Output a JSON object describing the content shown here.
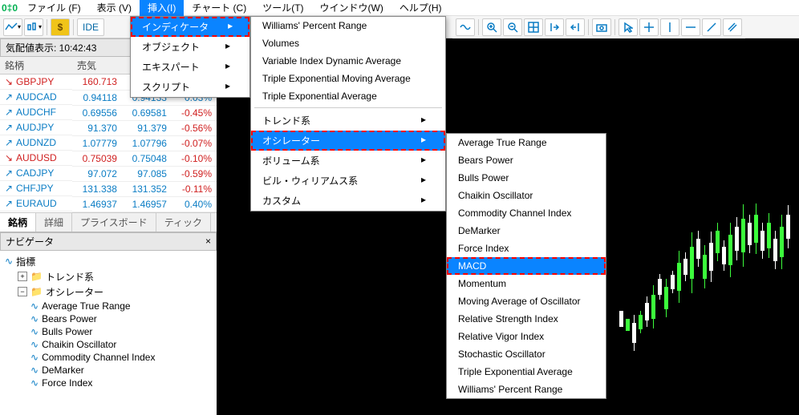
{
  "menubar": {
    "items": [
      "ファイル (F)",
      "表示 (V)",
      "挿入(I)",
      "チャート (C)",
      "ツール(T)",
      "ウインドウ(W)",
      "ヘルプ(H)"
    ],
    "active_index": 2
  },
  "toolbar": {
    "ide": "IDE"
  },
  "quotes_panel": {
    "title": "気配値表示: 10:42:43",
    "headers": [
      "銘柄",
      "売気"
    ],
    "rows": [
      {
        "sym": "GBPJPY",
        "dir": "dn",
        "bid": "160.713",
        "ask": "",
        "pct": ""
      },
      {
        "sym": "AUDCAD",
        "dir": "up",
        "bid": "0.94118",
        "ask": "0.94133",
        "pct": "0.03%"
      },
      {
        "sym": "AUDCHF",
        "dir": "up",
        "bid": "0.69556",
        "ask": "0.69581",
        "pct": "-0.45%"
      },
      {
        "sym": "AUDJPY",
        "dir": "up",
        "bid": "91.370",
        "ask": "91.379",
        "pct": "-0.56%"
      },
      {
        "sym": "AUDNZD",
        "dir": "up",
        "bid": "1.07779",
        "ask": "1.07796",
        "pct": "-0.07%"
      },
      {
        "sym": "AUDUSD",
        "dir": "dn",
        "bid": "0.75039",
        "ask": "0.75048",
        "pct": "-0.10%"
      },
      {
        "sym": "CADJPY",
        "dir": "up",
        "bid": "97.072",
        "ask": "97.085",
        "pct": "-0.59%"
      },
      {
        "sym": "CHFJPY",
        "dir": "up",
        "bid": "131.338",
        "ask": "131.352",
        "pct": "-0.11%"
      },
      {
        "sym": "EURAUD",
        "dir": "up",
        "bid": "1.46937",
        "ask": "1.46957",
        "pct": "0.40%"
      }
    ],
    "tabs": [
      "銘柄",
      "詳細",
      "プライスボード",
      "ティック"
    ],
    "active_tab": 0
  },
  "navigator": {
    "title": "ナビゲータ",
    "root": "指標",
    "groups": [
      {
        "name": "トレンド系",
        "open": false
      },
      {
        "name": "オシレーター",
        "open": true,
        "children": [
          "Average True Range",
          "Bears Power",
          "Bulls Power",
          "Chaikin Oscillator",
          "Commodity Channel Index",
          "DeMarker",
          "Force Index"
        ]
      }
    ]
  },
  "menu1": {
    "items": [
      {
        "label": "インディケータ",
        "arrow": true,
        "hi": true,
        "dash": true
      },
      {
        "label": "オブジェクト",
        "arrow": true
      },
      {
        "label": "エキスパート",
        "arrow": true
      },
      {
        "label": "スクリプト",
        "arrow": true
      }
    ]
  },
  "menu2": {
    "groups": [
      [
        "Williams' Percent Range",
        "Volumes",
        "Variable Index Dynamic Average",
        "Triple Exponential Moving Average",
        "Triple Exponential Average"
      ],
      [
        {
          "label": "トレンド系",
          "arrow": true
        },
        {
          "label": "オシレーター",
          "arrow": true,
          "hi": true,
          "dash": true
        },
        {
          "label": "ボリューム系",
          "arrow": true
        },
        {
          "label": "ビル・ウィリアムス系",
          "arrow": true
        },
        {
          "label": "カスタム",
          "arrow": true
        }
      ]
    ]
  },
  "menu3": {
    "items": [
      "Average True Range",
      "Bears Power",
      "Bulls Power",
      "Chaikin Oscillator",
      "Commodity Channel Index",
      "DeMarker",
      "Force Index",
      {
        "label": "MACD",
        "hi": true,
        "dash": true
      },
      "Momentum",
      "Moving Average of Oscillator",
      "Relative Strength Index",
      "Relative Vigor Index",
      "Stochastic Oscillator",
      "Triple Exponential Average",
      "Williams' Percent Range"
    ]
  }
}
